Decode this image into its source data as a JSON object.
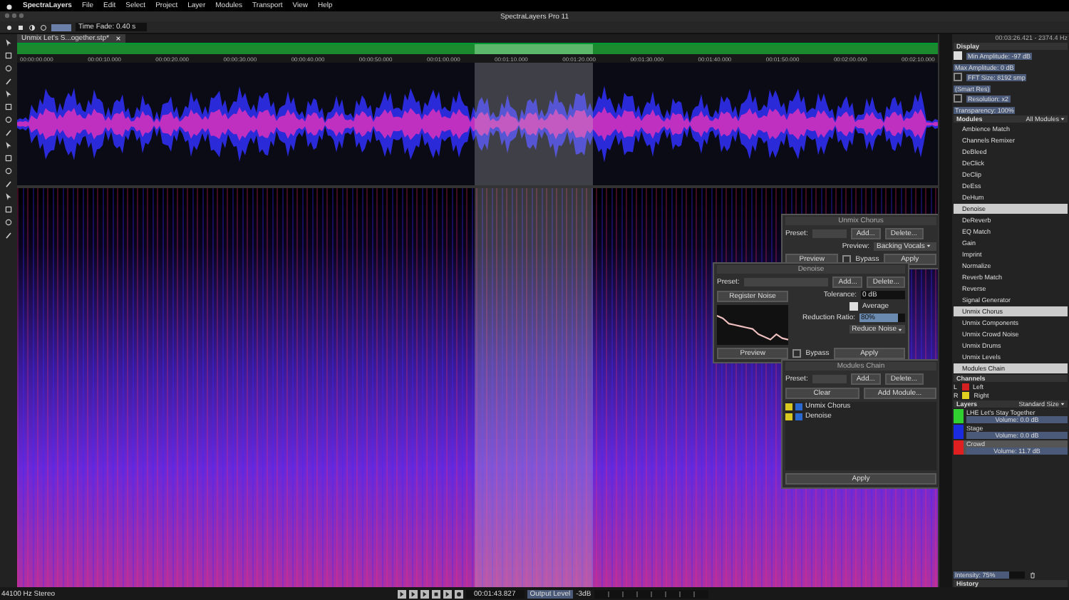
{
  "menu_bar": {
    "app": "SpectraLayers",
    "items": [
      "File",
      "Edit",
      "Select",
      "Project",
      "Layer",
      "Modules",
      "Transport",
      "View",
      "Help"
    ]
  },
  "window": {
    "title": "SpectraLayers Pro 11"
  },
  "toolbar": {
    "time_fade": "Time Fade: 0.40 s"
  },
  "document_tab": {
    "title": "Unmix Let's S...ogether.stp*"
  },
  "ruler": {
    "ticks": [
      "00:00:00.000",
      "00:00:10.000",
      "00:00:20.000",
      "00:00:30.000",
      "00:00:40.000",
      "00:00:50.000",
      "00:01:00.000",
      "00:01:10.000",
      "00:01:20.000",
      "00:01:30.000",
      "00:01:40.000",
      "00:01:50.000",
      "00:02:00.000",
      "00:02:10.000"
    ]
  },
  "cursor_readout": "00:03:26.421 - 2374.4 Hz",
  "display_panel": {
    "title": "Display",
    "rows": [
      {
        "label": "Min Amplitude: -97 dB",
        "value": "Max Amplitude: 0 dB",
        "checked": true
      },
      {
        "label": "FFT Size: 8192 smp",
        "value": "(Smart Res)",
        "checked": false
      },
      {
        "label": "Resolution: x2",
        "value": "Transparency: 100%",
        "checked": false
      }
    ]
  },
  "modules_panel": {
    "title": "Modules",
    "filter": "All Modules",
    "items": [
      {
        "label": "Ambience Match",
        "selected": false
      },
      {
        "label": "Channels Remixer",
        "selected": false
      },
      {
        "label": "DeBleed",
        "selected": false
      },
      {
        "label": "DeClick",
        "selected": false
      },
      {
        "label": "DeClip",
        "selected": false
      },
      {
        "label": "DeEss",
        "selected": false
      },
      {
        "label": "DeHum",
        "selected": false
      },
      {
        "label": "Denoise",
        "selected": true
      },
      {
        "label": "DeReverb",
        "selected": false
      },
      {
        "label": "EQ Match",
        "selected": false
      },
      {
        "label": "Gain",
        "selected": false
      },
      {
        "label": "Imprint",
        "selected": false
      },
      {
        "label": "Normalize",
        "selected": false
      },
      {
        "label": "Reverb Match",
        "selected": false
      },
      {
        "label": "Reverse",
        "selected": false
      },
      {
        "label": "Signal Generator",
        "selected": false
      },
      {
        "label": "Unmix Chorus",
        "selected": true
      },
      {
        "label": "Unmix Components",
        "selected": false
      },
      {
        "label": "Unmix Crowd Noise",
        "selected": false
      },
      {
        "label": "Unmix Drums",
        "selected": false
      },
      {
        "label": "Unmix Levels",
        "selected": false
      },
      {
        "label": "Modules Chain",
        "selected": true
      }
    ]
  },
  "channels_panel": {
    "title": "Channels",
    "channels": [
      {
        "letter": "L",
        "name": "Left",
        "color": "#d42020"
      },
      {
        "letter": "R",
        "name": "Right",
        "color": "#e0d020"
      }
    ]
  },
  "layers_panel": {
    "title": "Layers",
    "size": "Standard Size",
    "layers": [
      {
        "name": "LHE Let's Stay Together",
        "volume": "Volume: 0.0 dB",
        "color": "#30d030",
        "selected": false
      },
      {
        "name": "Stage",
        "volume": "Volume: 0.0 dB",
        "color": "#1a2be0",
        "selected": false
      },
      {
        "name": "Crowd",
        "volume": "Volume: 11.7 dB",
        "color": "#e02020",
        "selected": true
      }
    ],
    "intensity": {
      "label": "Intensity: 75%",
      "level": 0.75
    }
  },
  "history_panel": {
    "title": "History"
  },
  "unmix_chorus_dialog": {
    "title": "Unmix Chorus",
    "preset_label": "Preset:",
    "add": "Add...",
    "delete": "Delete...",
    "preview_label": "Preview:",
    "preview_value": "Backing Vocals",
    "preview_button": "Preview",
    "bypass": "Bypass",
    "bypass_checked": false,
    "apply": "Apply"
  },
  "denoise_dialog": {
    "title": "Denoise",
    "preset_label": "Preset:",
    "add": "Add...",
    "delete": "Delete...",
    "register": "Register Noise",
    "tolerance_label": "Tolerance:",
    "tolerance": "0 dB",
    "average": "Average",
    "average_checked": true,
    "ratio_label": "Reduction Ratio:",
    "ratio": "80%",
    "level": 0.8,
    "mode": "Reduce Noise",
    "preview_button": "Preview",
    "bypass": "Bypass",
    "bypass_checked": false,
    "apply": "Apply"
  },
  "modules_chain_dialog": {
    "title": "Modules Chain",
    "preset_label": "Preset:",
    "add": "Add...",
    "delete": "Delete...",
    "clear": "Clear",
    "add_module": "Add Module...",
    "modules": [
      "Unmix Chorus",
      "Denoise"
    ],
    "apply": "Apply"
  },
  "status_bar": {
    "format": "44100 Hz Stereo",
    "time": "00:01:43.827",
    "output_label": "Output Level",
    "output_value": "-3dB"
  }
}
